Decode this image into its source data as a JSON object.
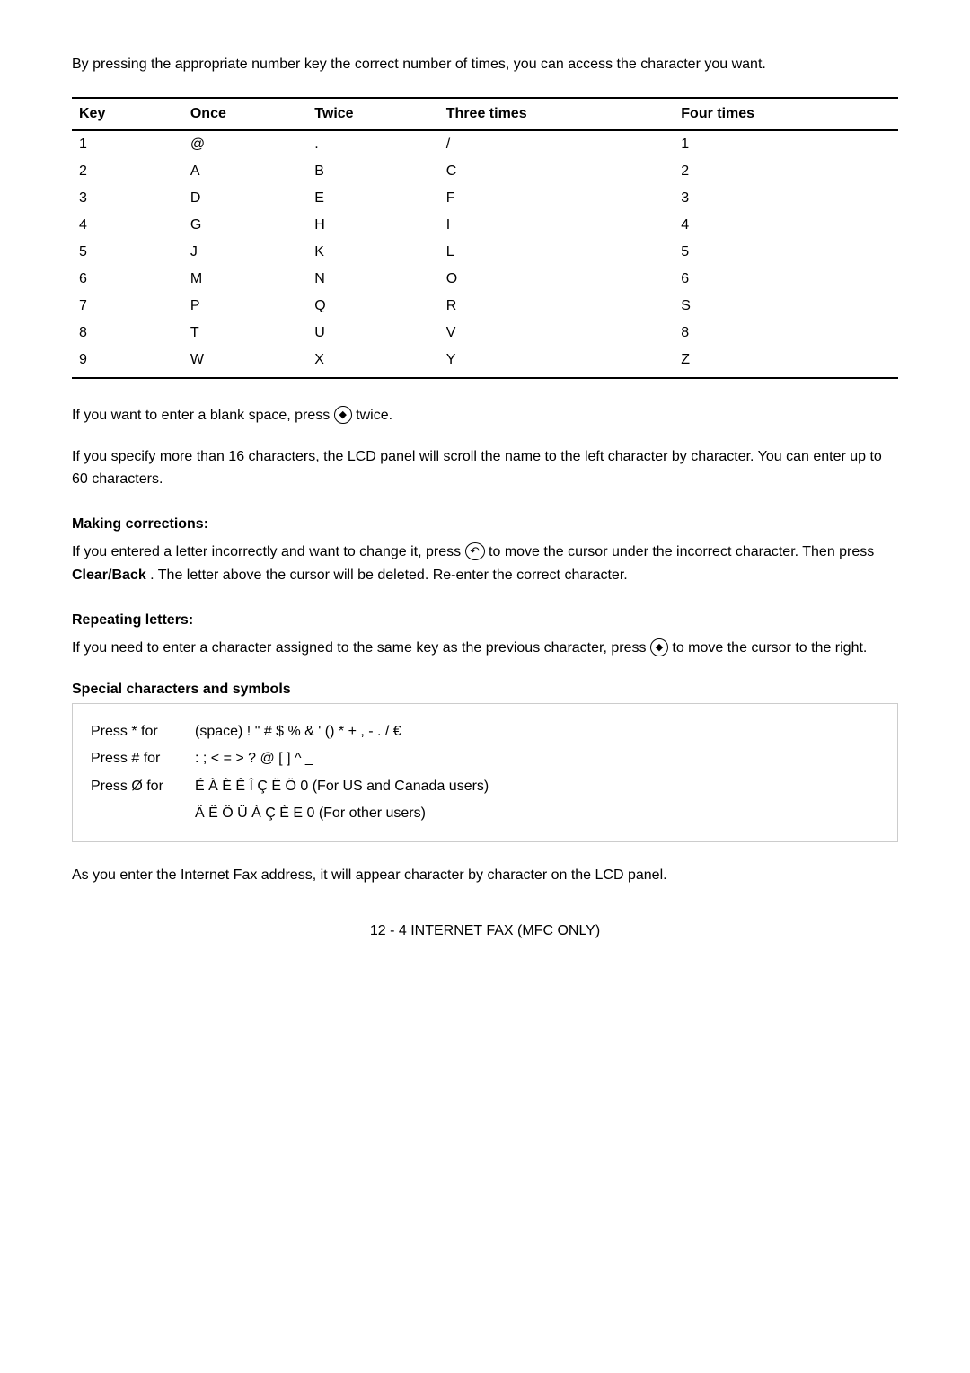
{
  "intro": {
    "text": "By pressing the appropriate number key the correct number of times, you can access the character you want."
  },
  "table": {
    "headers": [
      "Key",
      "Once",
      "Twice",
      "Three times",
      "Four times"
    ],
    "rows": [
      [
        "1",
        "@",
        ".",
        "/",
        "1"
      ],
      [
        "2",
        "A",
        "B",
        "C",
        "2"
      ],
      [
        "3",
        "D",
        "E",
        "F",
        "3"
      ],
      [
        "4",
        "G",
        "H",
        "I",
        "4"
      ],
      [
        "5",
        "J",
        "K",
        "L",
        "5"
      ],
      [
        "6",
        "M",
        "N",
        "O",
        "6"
      ],
      [
        "7",
        "P",
        "Q",
        "R",
        "S"
      ],
      [
        "8",
        "T",
        "U",
        "V",
        "8"
      ],
      [
        "9",
        "W",
        "X",
        "Y",
        "Z"
      ]
    ]
  },
  "blank_space": {
    "text_before": "If you want to enter a blank space, press ",
    "text_after": " twice."
  },
  "scroll_note": {
    "text": "If you specify more than 16 characters, the LCD panel will scroll the name to the left character by character. You can enter up to 60 characters."
  },
  "making_corrections": {
    "heading": "Making corrections:",
    "text_before": "If you entered a letter incorrectly and want to change it, press ",
    "text_after": " to move the cursor under the incorrect character. Then press ",
    "bold_word": "Clear/Back",
    "text_end": ". The letter above the cursor will be deleted. Re-enter the correct character."
  },
  "repeating_letters": {
    "heading": "Repeating letters:",
    "text_before": "If you need to enter a character assigned to the same key as the previous character, press ",
    "text_after": " to move the cursor to the right."
  },
  "special_chars": {
    "heading": "Special characters and symbols",
    "rows": [
      {
        "label": "Press * for",
        "value": "(space) ! \" # $ % & ' () * + , - . / €"
      },
      {
        "label": "Press # for",
        "value": ": ; < = > ? @ [ ] ^ _"
      },
      {
        "label": "Press Ø for",
        "value": "É À È Ê Î Ç Ë Ö 0  (For US and Canada users)"
      },
      {
        "label": "",
        "value": "Ä Ë Ö Ü À Ç È E 0 (For other users)"
      }
    ]
  },
  "internet_fax_note": {
    "text": "As you enter the Internet Fax address, it will appear character by character on the LCD panel."
  },
  "page_number": {
    "text": "12 - 4 INTERNET FAX (MFC ONLY)"
  }
}
